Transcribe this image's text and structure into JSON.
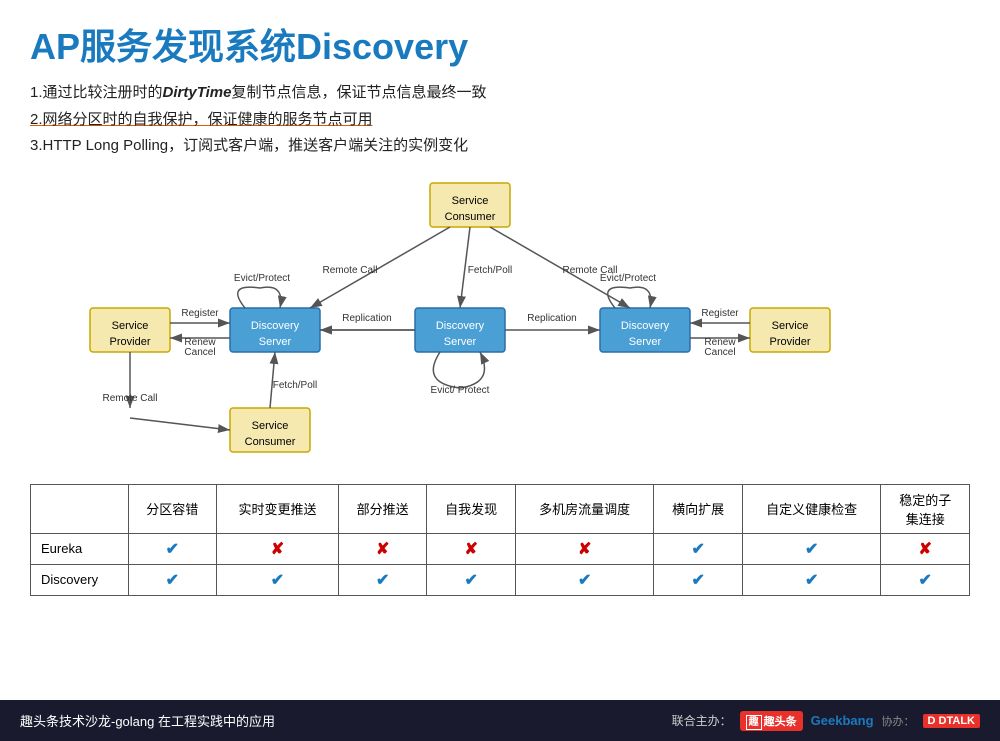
{
  "title": "AP服务发现系统Discovery",
  "bullets": [
    {
      "id": "b1",
      "text_before": "1.通过比较注册时的",
      "highlight": "DirtyTime",
      "text_after": "复制节点信息，保证节点信息最终一致"
    },
    {
      "id": "b2",
      "text": "2.网络分区时的自我保护，保证健康的服务节点可用",
      "underline": true
    },
    {
      "id": "b3",
      "text": "3.HTTP Long Polling，订阅式客户端，推送客户端关注的实例变化"
    }
  ],
  "diagram": {
    "nodes": {
      "service_consumer_top": "Service\nConsumer",
      "discovery_server_left": "Discovery\nServer",
      "discovery_server_center": "Discovery\nServer",
      "discovery_server_right": "Discovery\nServer",
      "service_provider_left": "Service\nProvider",
      "service_provider_right": "Service\nProvider",
      "service_consumer_bottom": "Service\nConsumer"
    },
    "labels": {
      "remote_call_left": "Remote Call",
      "remote_call_right": "Remote Call",
      "remote_call_bottom": "Remote Call",
      "fetch_poll_top": "Fetch/Poll",
      "fetch_poll_bottom": "Fetch/Poll",
      "register_left": "Register",
      "renew_cancel_left": "Renew\nCancel",
      "register_right": "Register",
      "renew_cancel_right": "Renew\nCancel",
      "evict_protect_left": "Evict/Protect",
      "evict_protect_right": "Evict/Protect",
      "evict_protect_bottom": "Evict/ Protect",
      "replication_left": "Replication",
      "replication_right": "Replication"
    }
  },
  "table": {
    "headers": [
      "",
      "分区容错",
      "实时变更推送",
      "部分推送",
      "自我发现",
      "多机房流量调度",
      "横向扩展",
      "自定义健康检查",
      "稳定的子\n集连接"
    ],
    "rows": [
      {
        "name": "Eureka",
        "values": [
          "check",
          "cross",
          "cross",
          "cross",
          "cross",
          "check",
          "check",
          "cross"
        ]
      },
      {
        "name": "Discovery",
        "values": [
          "check",
          "check",
          "check",
          "check",
          "check",
          "check",
          "check",
          "check"
        ]
      }
    ]
  },
  "footer": {
    "left_text": "趣头条技术沙龙-golang 在工程实践中的应用",
    "joint_label": "联合主办：",
    "toutiao_label": "趣头条",
    "geekbang_label": "Geekbang",
    "cohost_label": "协办：",
    "dtalk_label": "DTALK"
  }
}
